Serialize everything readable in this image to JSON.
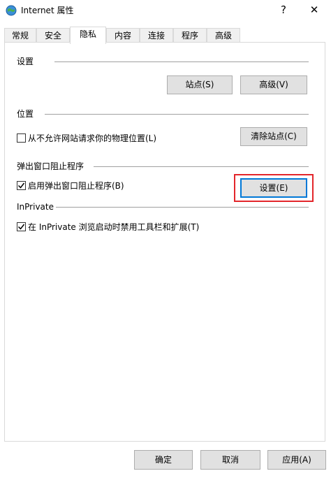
{
  "window": {
    "title": "Internet 属性",
    "help_label": "?",
    "close_label": "✕"
  },
  "tabs": [
    {
      "label": "常规"
    },
    {
      "label": "安全"
    },
    {
      "label": "隐私"
    },
    {
      "label": "内容"
    },
    {
      "label": "连接"
    },
    {
      "label": "程序"
    },
    {
      "label": "高级"
    }
  ],
  "active_tab": "隐私",
  "settings": {
    "group_label": "设置",
    "sites_button": "站点(S)",
    "advanced_button": "高级(V)"
  },
  "location": {
    "group_label": "位置",
    "never_allow_label": "从不允许网站请求你的物理位置(L)",
    "never_allow_checked": false,
    "clear_sites_button": "清除站点(C)"
  },
  "popup_blocker": {
    "group_label": "弹出窗口阻止程序",
    "enable_label": "启用弹出窗口阻止程序(B)",
    "enable_checked": true,
    "settings_button": "设置(E)"
  },
  "inprivate": {
    "group_label": "InPrivate",
    "disable_label": "在 InPrivate 浏览启动时禁用工具栏和扩展(T)",
    "disable_checked": true
  },
  "footer": {
    "ok_button": "确定",
    "cancel_button": "取消",
    "apply_button": "应用(A)"
  },
  "colors": {
    "highlight": "#e3262b",
    "focus_border": "#0078d7",
    "button_face": "#e1e1e1"
  }
}
